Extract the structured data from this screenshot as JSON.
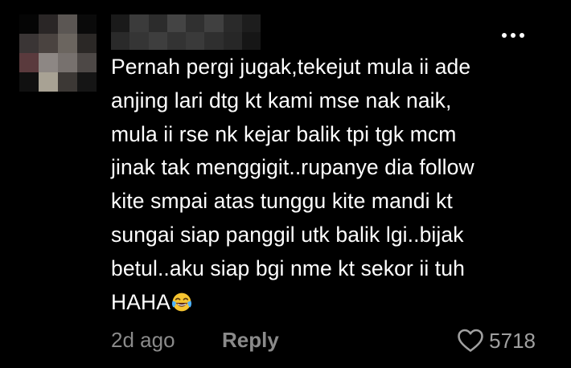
{
  "comment": {
    "username_display": "",
    "lines": [
      "Pernah pergi jugak,tekejut mula ii ade",
      "anjing lari dtg kt kami mse nak naik,",
      "mula ii rse nk kejar balik tpi tgk mcm",
      "jinak tak menggigit..rupanye dia follow",
      "kite smpai atas tunggu kite mandi kt",
      "sungai siap panggil utk balik lgi..bijak",
      "betul..aku siap bgi nme kt sekor ii tuh",
      "HAHA"
    ],
    "emoji": "face-with-tears-of-joy-emoji",
    "time": "2d ago",
    "reply_label": "Reply",
    "like_count": "5718"
  },
  "icons": {
    "more": "more-horizontal-icon",
    "like": "heart-outline-icon"
  },
  "colors": {
    "background": "#000000",
    "text": "#ffffff",
    "meta_text": "#8a8a8a",
    "icon": "#a0a0a0"
  }
}
